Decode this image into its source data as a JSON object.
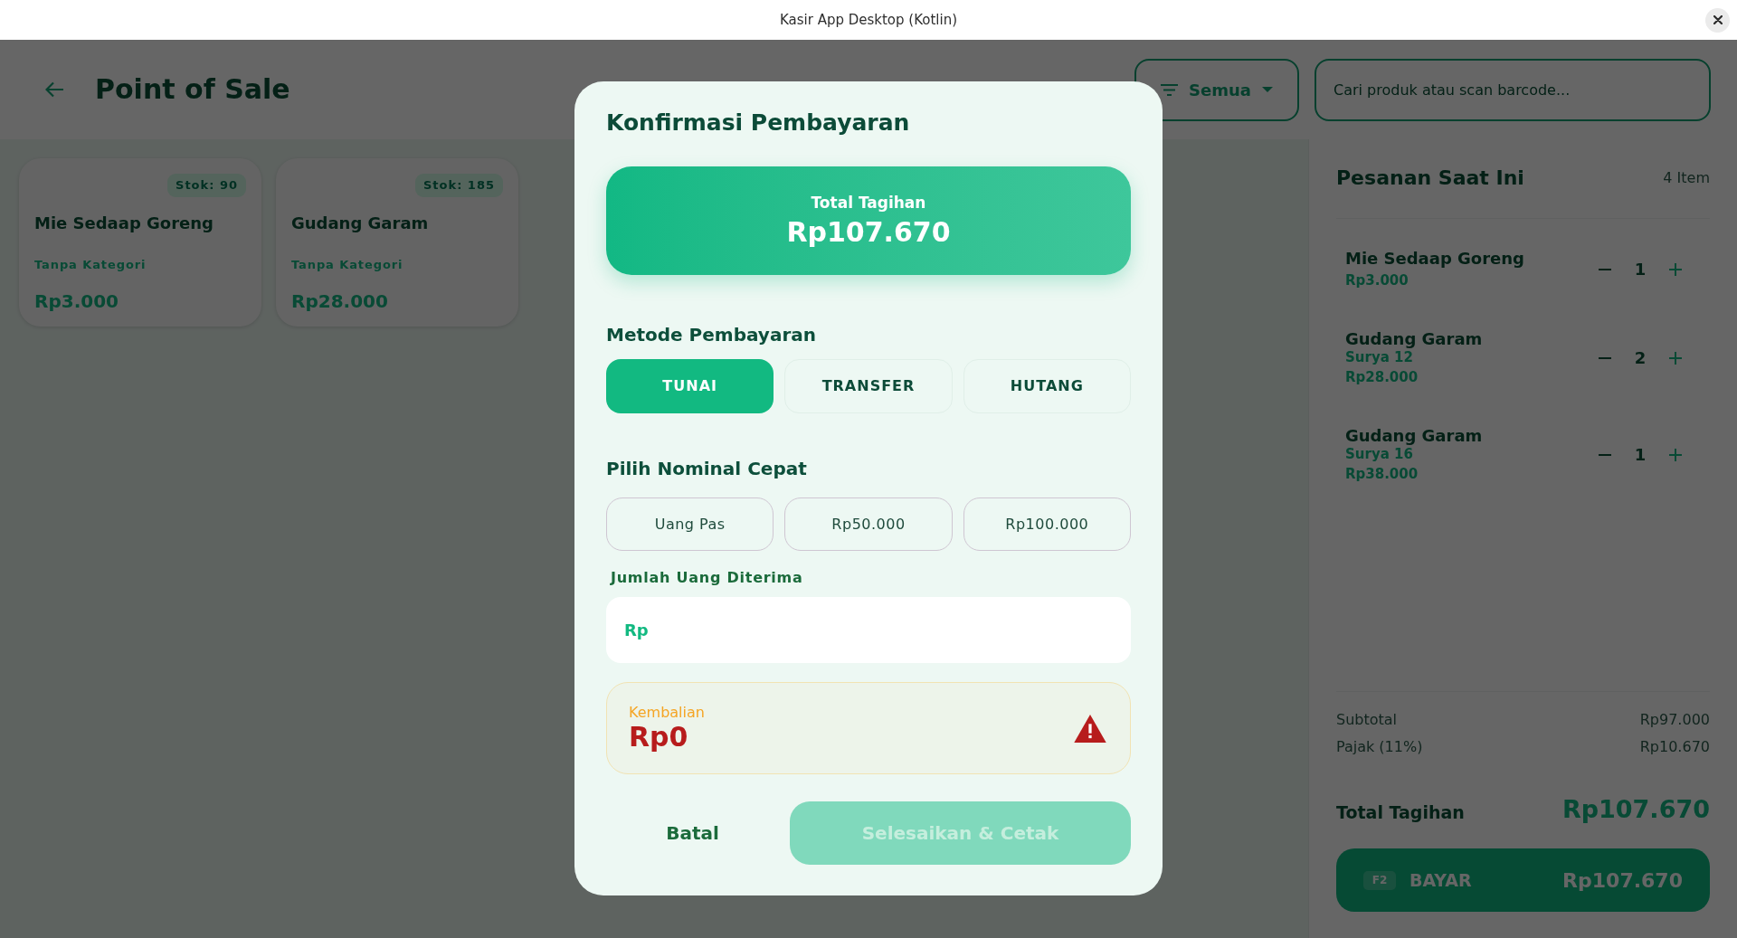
{
  "window": {
    "title": "Kasir App Desktop (Kotlin)"
  },
  "header": {
    "title": "Point of Sale",
    "filter": {
      "label": "Semua"
    },
    "search": {
      "placeholder": "Cari produk atau scan barcode..."
    }
  },
  "products": [
    {
      "stock": "Stok: 90",
      "name": "Mie Sedaap Goreng",
      "category": "Tanpa Kategori",
      "price": "Rp3.000"
    },
    {
      "stock": "Stok: 185",
      "name": "Gudang Garam",
      "category": "Tanpa Kategori",
      "price": "Rp28.000"
    }
  ],
  "order": {
    "title": "Pesanan Saat Ini",
    "count": "4 Item",
    "items": [
      {
        "name": "Mie Sedaap Goreng",
        "price": "Rp3.000",
        "quantity": "1"
      },
      {
        "name": "Gudang Garam",
        "variant": "Surya 12",
        "price": "Rp28.000",
        "quantity": "2"
      },
      {
        "name": "Gudang Garam",
        "variant": "Surya 16",
        "price": "Rp38.000",
        "quantity": "1"
      }
    ],
    "summary": [
      {
        "label": "Subtotal",
        "value": "Rp97.000"
      },
      {
        "label": "Pajak (11%)",
        "value": "Rp10.670"
      }
    ],
    "total": {
      "label": "Total Tagihan",
      "value": "Rp107.670"
    },
    "pay_button": {
      "shortcut": "F2",
      "label": "BAYAR",
      "amount": "Rp107.670"
    }
  },
  "dialog": {
    "title": "Konfirmasi Pembayaran",
    "total": {
      "label": "Total Tagihan",
      "value": "Rp107.670"
    },
    "method_heading": "Metode Pembayaran",
    "methods": [
      {
        "label": "TUNAI",
        "selected": true
      },
      {
        "label": "TRANSFER",
        "selected": false
      },
      {
        "label": "HUTANG",
        "selected": false
      }
    ],
    "quick_heading": "Pilih Nominal Cepat",
    "quick_amounts": [
      "Uang Pas",
      "Rp50.000",
      "Rp100.000"
    ],
    "amount_field": {
      "label": "Jumlah Uang Diterima",
      "prefix": "Rp"
    },
    "change": {
      "label": "Kembalian",
      "value": "Rp0",
      "warning": true
    },
    "buttons": {
      "cancel": "Batal",
      "confirm": {
        "label": "Selesaikan & Cetak",
        "disabled": true
      }
    }
  }
}
